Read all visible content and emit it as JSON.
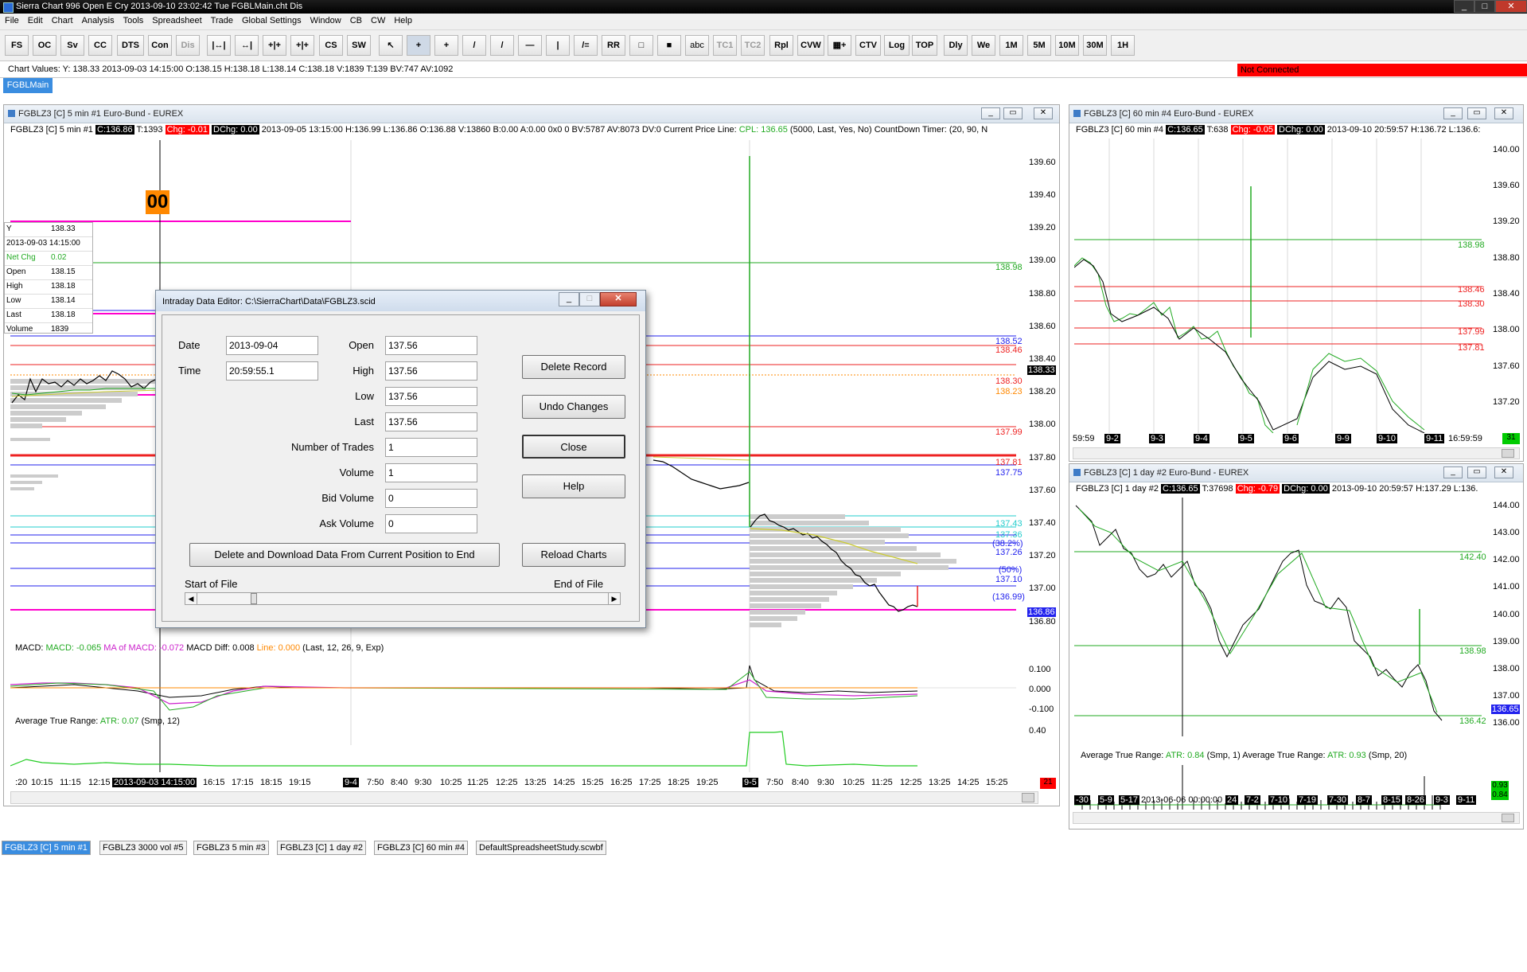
{
  "app_title": "Sierra Chart 996 Open E Cry 2013-09-10  23:02:42 Tue  FGBLMain.cht Dis",
  "menu": [
    "File",
    "Edit",
    "Chart",
    "Analysis",
    "Tools",
    "Spreadsheet",
    "Trade",
    "Global Settings",
    "Window",
    "CB",
    "CW",
    "Help"
  ],
  "toolbar": [
    "FS",
    "OC",
    "Sv",
    "CC",
    "DTS",
    "Con",
    "Dis",
    "|↔|",
    "↔|",
    "+|+",
    "+|+",
    "CS",
    "SW",
    "↖",
    "+",
    "+",
    "/",
    "/",
    "—",
    "|",
    "/≡",
    "RR",
    "□",
    "■",
    "abc",
    "TC1",
    "TC2",
    "Rpl",
    "CVW",
    "▦+",
    "CTV",
    "Log",
    "TOP",
    "Dly",
    "We",
    "1M",
    "5M",
    "10M",
    "30M",
    "1H"
  ],
  "chart_values_text": "Chart Values: Y: 138.33  2013-09-03  14:15:00  O:138.15  H:138.18  L:138.14  C:138.18  V:1839  T:139  BV:747  AV:1092",
  "not_connected": "Not Connected",
  "chartbook_tab": "FGBLMain",
  "chart1": {
    "caption": "FGBLZ3 [C]  5 min   #1  Euro-Bund - EUREX",
    "hdr_sym": "FGBLZ3 [C]  5 min   #1",
    "hdr_last": "C:136.86",
    "hdr_t": "T:1393",
    "hdr_chg": "Chg: -0.01",
    "hdr_dchg": "DChg: 0.00",
    "hdr_rest": "2013-09-05 13:15:00  H:136.99  L:136.86  O:136.88  V:13860  B:0.00  A:0.00  0x0  0  BV:5787  AV:8073  DV:0  Current Price Line:",
    "hdr_cpl": "CPL: 136.65",
    "hdr_tail": "(5000, Last, Yes, No)  CountDown Timer:  (20, 90, N",
    "countdown": "00",
    "y_axis": [
      "139.60",
      "139.40",
      "139.20",
      "139.00",
      "138.80",
      "138.60",
      "138.40",
      "138.20",
      "138.00",
      "137.80",
      "137.60",
      "137.40",
      "137.20",
      "137.00",
      "136.80"
    ],
    "level_labels": [
      {
        "text": "138.98",
        "color": "#22aa22"
      },
      {
        "text": "138.52",
        "color": "#2222ee"
      },
      {
        "text": "138.46",
        "color": "#ee2222"
      },
      {
        "text": "138.33",
        "color": "#ffffff"
      },
      {
        "text": "138.30",
        "color": "#ee2222"
      },
      {
        "text": "138.23",
        "color": "#ff8800"
      },
      {
        "text": "137.99",
        "color": "#ee2222"
      },
      {
        "text": "137.81",
        "color": "#ee2222"
      },
      {
        "text": "137.75",
        "color": "#2222ee"
      },
      {
        "text": "137.43",
        "color": "#22cccc"
      },
      {
        "text": "137.36",
        "color": "#22cccc"
      },
      {
        "text": "(38.2%)",
        "color": "#2222ee"
      },
      {
        "text": "137.26",
        "color": "#2222ee"
      },
      {
        "text": "(50%)",
        "color": "#2222ee"
      },
      {
        "text": "137.10",
        "color": "#2222ee"
      },
      {
        "text": "(136.99)",
        "color": "#2222ee"
      },
      {
        "text": "136.86",
        "color": "#ffffff"
      }
    ],
    "data_window": [
      {
        "k": "Y",
        "v": "138.33"
      },
      {
        "k": "2013-09-03  14:15:00",
        "v": ""
      },
      {
        "k": "Net Chg",
        "v": "0.02"
      },
      {
        "k": "Open",
        "v": "138.15"
      },
      {
        "k": "High",
        "v": "138.18"
      },
      {
        "k": "Low",
        "v": "138.14"
      },
      {
        "k": "Last",
        "v": "138.18"
      },
      {
        "k": "Volume",
        "v": "1839"
      }
    ],
    "macd_label": "MACD:",
    "macd_v": "MACD: -0.065",
    "macd_ma": "MA of MACD: -0.072",
    "macd_diff": "MACD Diff: 0.008",
    "macd_line": "Line: 0.000",
    "macd_params": "(Last, 12, 26, 9, Exp)",
    "macd_axis": [
      "0.100",
      "0.000",
      "-0.100"
    ],
    "atr_label": "Average True Range:",
    "atr_v": "ATR: 0.07",
    "atr_params": "(Smp, 12)",
    "atr_axis": "0.40",
    "x_axis": [
      ":20",
      "10:15",
      "11:15",
      "12:15",
      "2013-09-03  14:15:00",
      "16:15",
      "17:15",
      "18:15",
      "19:15",
      "9-4",
      "7:50",
      "8:40",
      "9:30",
      "10:25",
      "11:25",
      "12:25",
      "13:25",
      "14:25",
      "15:25",
      "16:25",
      "17:25",
      "18:25",
      "19:25",
      "9-5",
      "7:50",
      "8:40",
      "9:30",
      "10:25",
      "11:25",
      "12:25",
      "13:25",
      "14:25",
      "15:25"
    ],
    "corner": "21"
  },
  "chart4": {
    "caption": "FGBLZ3 [C]  60 min   #4  Euro-Bund - EUREX",
    "hdr_sym": "FGBLZ3 [C]  60 min   #4",
    "hdr_last": "C:136.65",
    "hdr_t": "T:638",
    "hdr_chg": "Chg: -0.05",
    "hdr_dchg": "DChg: 0.00",
    "hdr_rest": "2013-09-10  20:59:57  H:136.72  L:136.6:",
    "y_axis": [
      "140.00",
      "139.60",
      "139.20",
      "138.80",
      "138.40",
      "138.00",
      "137.60",
      "137.20"
    ],
    "levels": [
      {
        "text": "138.98",
        "color": "#22aa22"
      },
      {
        "text": "138.46",
        "color": "#ee2222"
      },
      {
        "text": "138.30",
        "color": "#ee2222"
      },
      {
        "text": "137.99",
        "color": "#ee2222"
      },
      {
        "text": "137.81",
        "color": "#ee2222"
      }
    ],
    "x_axis": [
      "59:59",
      "9-2",
      "9-3",
      "9-4",
      "9-5",
      "9-6",
      "9-9",
      "9-10",
      "9-11",
      "16:59:59"
    ],
    "corner": "31"
  },
  "chart2": {
    "caption": "FGBLZ3 [C]  1 day   #2  Euro-Bund - EUREX",
    "hdr_sym": "FGBLZ3 [C]  1 day   #2",
    "hdr_last": "C:136.65",
    "hdr_t": "T:37698",
    "hdr_chg": "Chg: -0.79",
    "hdr_dchg": "DChg: 0.00",
    "hdr_rest": "2013-09-10  20:59:57  H:137.29  L:136.",
    "y_axis": [
      "144.00",
      "143.00",
      "142.00",
      "141.00",
      "140.00",
      "139.00",
      "138.00",
      "137.00",
      "136.00"
    ],
    "levels": [
      {
        "text": "142.40",
        "color": "#22aa22"
      },
      {
        "text": "138.98",
        "color": "#22aa22"
      },
      {
        "text": "136.65",
        "color": "#ffffff"
      },
      {
        "text": "136.42",
        "color": "#22aa22"
      }
    ],
    "atr_label": "Average True Range:",
    "atr1_v": "ATR: 0.84",
    "atr1_params": "(Smp, 1)",
    "atr2_label": "Average True Range:",
    "atr2_v": "ATR: 0.93",
    "atr2_params": "(Smp, 20)",
    "x_axis": [
      "-30",
      "5-9",
      "5-17",
      "2013-06-06  00:00:00",
      "24",
      "7-2",
      "7-10",
      "7-19",
      "7-30",
      "8-7",
      "8-15",
      "8-26",
      "9-3",
      "9-11"
    ],
    "atr_axis_a": "0.93",
    "atr_axis_b": "0.84"
  },
  "dialog": {
    "title": "Intraday Data Editor:  C:\\SierraChart\\Data\\FGBLZ3.scid",
    "labels": {
      "date": "Date",
      "time": "Time",
      "open": "Open",
      "high": "High",
      "low": "Low",
      "last": "Last",
      "trades": "Number of Trades",
      "volume": "Volume",
      "bidvol": "Bid Volume",
      "askvol": "Ask Volume",
      "start": "Start of File",
      "end": "End of File"
    },
    "values": {
      "date": "2013-09-04",
      "time": "20:59:55.1",
      "open": "137.56",
      "high": "137.56",
      "low": "137.56",
      "last": "137.56",
      "trades": "1",
      "volume": "1",
      "bidvol": "0",
      "askvol": "0"
    },
    "buttons": {
      "delete_record": "Delete Record",
      "undo": "Undo Changes",
      "close": "Close",
      "help": "Help",
      "download": "Delete and Download Data From Current Position to End",
      "reload": "Reload Charts"
    }
  },
  "bottom_tabs": [
    "FGBLZ3 [C]  5 min   #1",
    "FGBLZ3  3000 vol  #5",
    "FGBLZ3  5 min   #3",
    "FGBLZ3 [C]  1 day   #2",
    "FGBLZ3 [C]  60 min   #4",
    "DefaultSpreadsheetStudy.scwbf"
  ],
  "colors": {
    "accent": "#3a8de0",
    "not_connected": "#ff0000",
    "price_up": "#22aa22",
    "price_down": "#000000"
  }
}
